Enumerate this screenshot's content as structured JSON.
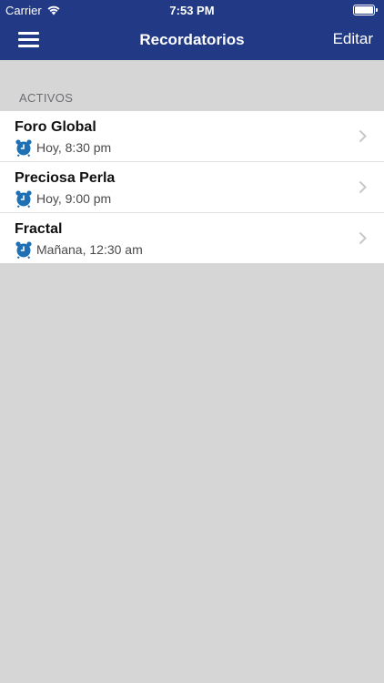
{
  "status_bar": {
    "carrier": "Carrier",
    "time": "7:53 PM",
    "wifi_icon": "wifi-icon",
    "battery_icon": "battery-icon"
  },
  "nav": {
    "menu_icon": "hamburger-menu-icon",
    "title": "Recordatorios",
    "edit_label": "Editar"
  },
  "section": {
    "header": "ACTIVOS"
  },
  "reminders": [
    {
      "title": "Foro Global",
      "time": "Hoy, 8:30 pm",
      "icon": "alarm-clock-icon"
    },
    {
      "title": "Preciosa Perla",
      "time": "Hoy, 9:00 pm",
      "icon": "alarm-clock-icon"
    },
    {
      "title": "Fractal",
      "time": "Mañana, 12:30 am",
      "icon": "alarm-clock-icon"
    }
  ],
  "colors": {
    "header_bg": "#223a86",
    "page_bg": "#d6d6d6",
    "icon_blue": "#1f6fb5"
  }
}
